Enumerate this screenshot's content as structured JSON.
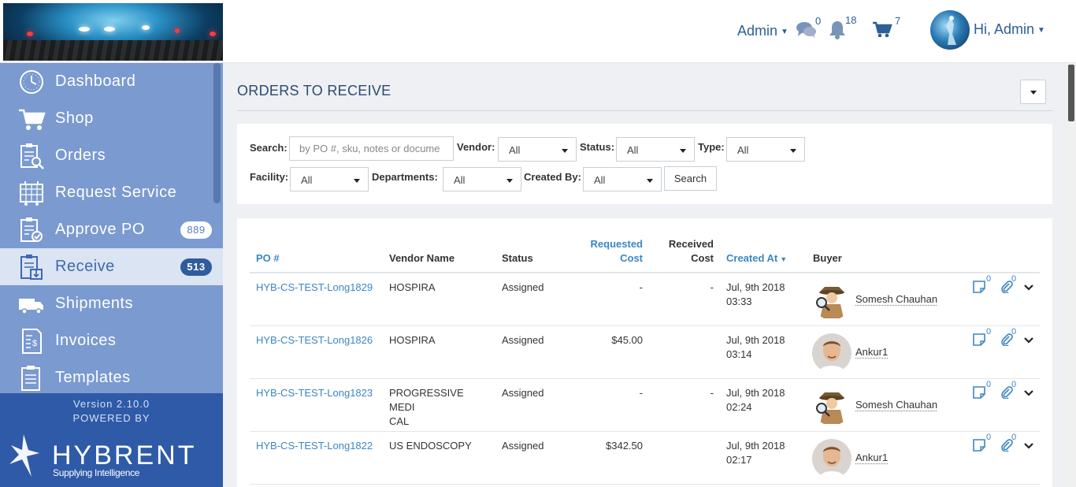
{
  "header": {
    "admin_menu": "Admin",
    "messages_count": "0",
    "notifications_count": "18",
    "cart_count": "7",
    "user_greeting": "Hi, Admin"
  },
  "sidebar": {
    "items": [
      {
        "label": "Dashboard",
        "icon": "clock-icon"
      },
      {
        "label": "Shop",
        "icon": "cart-icon"
      },
      {
        "label": "Orders",
        "icon": "clipboard-search-icon"
      },
      {
        "label": "Request Service",
        "icon": "calendar-cart-icon"
      },
      {
        "label": "Approve PO",
        "icon": "clipboard-check-icon",
        "badge": "889"
      },
      {
        "label": "Receive",
        "icon": "clipboard-receive-icon",
        "badge": "513",
        "active": true
      },
      {
        "label": "Shipments",
        "icon": "truck-icon"
      },
      {
        "label": "Invoices",
        "icon": "invoice-icon"
      },
      {
        "label": "Templates",
        "icon": "clipboard-list-icon"
      }
    ],
    "version": "Version 2.10.0",
    "powered_by": "POWERED BY",
    "brand_name": "HYBRENT",
    "brand_tagline": "Supplying Intelligence"
  },
  "page": {
    "title": "ORDERS TO RECEIVE"
  },
  "filters": {
    "search_label": "Search:",
    "search_placeholder": "by PO #, sku, notes or docume",
    "vendor_label": "Vendor:",
    "vendor_value": "All",
    "status_label": "Status:",
    "status_value": "All",
    "type_label": "Type:",
    "type_value": "All",
    "facility_label": "Facility:",
    "facility_value": "All",
    "departments_label": "Departments:",
    "departments_value": "All",
    "created_by_label": "Created By:",
    "created_by_value": "All",
    "search_button": "Search"
  },
  "table": {
    "headers": {
      "po": "PO #",
      "vendor": "Vendor Name",
      "status": "Status",
      "requested_1": "Requested",
      "requested_2": "Cost",
      "received_1": "Received",
      "received_2": "Cost",
      "created": "Created At",
      "buyer": "Buyer"
    },
    "rows": [
      {
        "po": "HYB-CS-TEST-Long1829",
        "vendor_1": "HOSPIRA",
        "vendor_2": "",
        "status": "Assigned",
        "requested": "-",
        "received": "-",
        "date": "Jul, 9th 2018",
        "time": "03:33",
        "buyer": "Somesh Chauhan",
        "notes": "0",
        "attachments": "0"
      },
      {
        "po": "HYB-CS-TEST-Long1826",
        "vendor_1": "HOSPIRA",
        "vendor_2": "",
        "status": "Assigned",
        "requested": "$45.00",
        "received": "",
        "date": "Jul, 9th 2018",
        "time": "03:14",
        "buyer": "Ankur1",
        "notes": "0",
        "attachments": "0"
      },
      {
        "po": "HYB-CS-TEST-Long1823",
        "vendor_1": "PROGRESSIVE MEDI",
        "vendor_2": "CAL",
        "status": "Assigned",
        "requested": "-",
        "received": "-",
        "date": "Jul, 9th 2018",
        "time": "02:24",
        "buyer": "Somesh Chauhan",
        "notes": "0",
        "attachments": "0"
      },
      {
        "po": "HYB-CS-TEST-Long1822",
        "vendor_1": "US ENDOSCOPY",
        "vendor_2": "",
        "status": "Assigned",
        "requested": "$342.50",
        "received": "",
        "date": "Jul, 9th 2018",
        "time": "02:17",
        "buyer": "Ankur1",
        "notes": "0",
        "attachments": "0"
      }
    ]
  },
  "colors": {
    "sidebar_bg": "#7a9ad0",
    "sidebar_footer": "#2e5aa8",
    "link": "#3c86c4",
    "header_text": "#2c5f97"
  }
}
